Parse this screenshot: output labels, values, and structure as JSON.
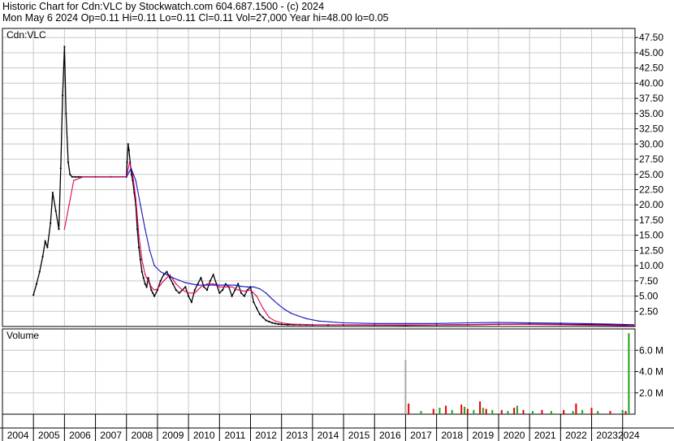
{
  "header": {
    "line1": "Historic Chart for Cdn:VLC by Stockwatch.com 604.687.1500 - (c) 2024",
    "line2": "Mon May  6 2024  Op=0.11  Hi=0.11  Lo=0.11  Cl=0.11  Vol=27,000  Year hi=48.00  lo=0.05"
  },
  "colors": {
    "price": "#000000",
    "ma_short": "#e00060",
    "ma_long": "#1010c0",
    "vol_up": "#20a020",
    "vol_down": "#e00000",
    "vol_big": "#a8a8a8",
    "grid": "#c8c8c8"
  },
  "chart_data": [
    {
      "type": "line",
      "title": "Cdn:VLC",
      "xlabel": "",
      "ylabel": "",
      "x_ticks": [
        "2004",
        "2005",
        "2006",
        "2007",
        "2008",
        "2009",
        "2010",
        "2011",
        "2012",
        "2013",
        "2014",
        "2015",
        "2016",
        "2017",
        "2018",
        "2019",
        "2020",
        "2021",
        "2022",
        "2023",
        "2024"
      ],
      "y_ticks": [
        "2.50",
        "5.00",
        "7.50",
        "10.00",
        "12.50",
        "15.00",
        "17.50",
        "20.00",
        "22.50",
        "25.00",
        "27.50",
        "30.00",
        "32.50",
        "35.00",
        "37.50",
        "40.00",
        "42.50",
        "45.00",
        "47.50"
      ],
      "ylim": [
        0,
        49
      ],
      "xlim": [
        2004.0,
        2024.4
      ],
      "grid": true,
      "series": [
        {
          "kind": "price",
          "x": [
            2005.0,
            2005.1,
            2005.2,
            2005.3,
            2005.38,
            2005.45,
            2005.55,
            2005.62,
            2005.72,
            2005.82,
            2005.88,
            2005.94,
            2006.0,
            2006.05,
            2006.12,
            2006.18,
            2006.25,
            2006.35,
            2006.45,
            2007.0,
            2007.5,
            2008.0,
            2008.02,
            2008.05,
            2008.08,
            2008.12,
            2008.16,
            2008.2,
            2008.25,
            2008.3,
            2008.35,
            2008.4,
            2008.45,
            2008.5,
            2008.55,
            2008.6,
            2008.65,
            2008.7,
            2008.75,
            2008.8,
            2008.85,
            2008.9,
            2009.0,
            2009.1,
            2009.2,
            2009.3,
            2009.4,
            2009.5,
            2009.6,
            2009.7,
            2009.8,
            2009.9,
            2010.0,
            2010.1,
            2010.2,
            2010.3,
            2010.4,
            2010.5,
            2010.6,
            2010.7,
            2010.8,
            2010.9,
            2011.0,
            2011.1,
            2011.2,
            2011.3,
            2011.4,
            2011.5,
            2011.6,
            2011.7,
            2011.8,
            2011.9,
            2012.0,
            2012.1,
            2012.2,
            2012.3,
            2012.4,
            2012.5,
            2012.6,
            2012.7,
            2012.8,
            2012.9,
            2013.0,
            2013.2,
            2013.4,
            2013.6,
            2013.8,
            2014.0,
            2014.5,
            2015.0,
            2016.0,
            2017.0,
            2018.0,
            2019.0,
            2020.0,
            2021.0,
            2022.0,
            2023.0,
            2024.0,
            2024.35
          ],
          "y": [
            5.2,
            7.0,
            9.0,
            11.5,
            14.0,
            13.0,
            17.0,
            22.0,
            19.0,
            16.0,
            26.0,
            38.0,
            46.0,
            35.0,
            27.0,
            25.0,
            24.6,
            24.6,
            24.6,
            24.6,
            24.6,
            24.6,
            27.0,
            30.0,
            29.0,
            27.0,
            25.0,
            24.0,
            22.0,
            20.0,
            16.0,
            13.0,
            11.0,
            9.0,
            8.0,
            7.0,
            6.5,
            8.0,
            7.0,
            6.0,
            5.5,
            5.0,
            6.0,
            7.5,
            8.5,
            9.0,
            8.0,
            7.0,
            6.0,
            5.5,
            6.0,
            6.5,
            5.0,
            4.0,
            6.0,
            7.0,
            8.0,
            6.5,
            6.0,
            7.5,
            8.5,
            7.0,
            5.5,
            6.0,
            7.0,
            6.5,
            5.0,
            6.0,
            7.0,
            5.5,
            5.0,
            6.0,
            6.5,
            4.0,
            3.0,
            2.0,
            1.5,
            1.0,
            0.8,
            0.6,
            0.5,
            0.4,
            0.35,
            0.3,
            0.3,
            0.28,
            0.27,
            0.26,
            0.25,
            0.25,
            0.24,
            0.2,
            0.25,
            0.3,
            0.35,
            0.4,
            0.35,
            0.3,
            0.2,
            0.11
          ]
        },
        {
          "kind": "short_ma",
          "x": [
            2006.0,
            2006.15,
            2006.3,
            2006.6,
            2007.0,
            2007.5,
            2008.0,
            2008.1,
            2008.2,
            2008.3,
            2008.4,
            2008.5,
            2008.6,
            2008.7,
            2008.8,
            2008.9,
            2009.0,
            2009.2,
            2009.4,
            2009.6,
            2009.8,
            2010.0,
            2010.2,
            2010.4,
            2010.6,
            2010.8,
            2011.0,
            2011.2,
            2011.4,
            2011.6,
            2011.8,
            2012.0,
            2012.2,
            2012.4,
            2012.6,
            2012.8,
            2013.0,
            2013.3,
            2013.6,
            2014.0,
            2015.0,
            2016.0,
            2017.0,
            2018.0,
            2019.0,
            2020.0,
            2021.0,
            2022.0,
            2023.0,
            2024.0,
            2024.35
          ],
          "y": [
            16.0,
            20.0,
            24.0,
            24.6,
            24.6,
            24.6,
            24.6,
            27.0,
            25.0,
            21.0,
            15.0,
            11.0,
            8.5,
            7.5,
            6.5,
            6.0,
            6.2,
            7.5,
            8.5,
            7.0,
            6.0,
            5.5,
            5.5,
            6.5,
            7.0,
            7.0,
            6.5,
            6.5,
            6.5,
            6.0,
            5.8,
            6.0,
            5.0,
            3.0,
            1.5,
            0.9,
            0.6,
            0.4,
            0.35,
            0.3,
            0.28,
            0.26,
            0.25,
            0.27,
            0.32,
            0.38,
            0.35,
            0.3,
            0.22,
            0.15,
            0.12
          ]
        },
        {
          "kind": "long_ma",
          "x": [
            2008.0,
            2008.15,
            2008.3,
            2008.45,
            2008.6,
            2008.75,
            2008.9,
            2009.1,
            2009.3,
            2009.5,
            2009.7,
            2009.9,
            2010.1,
            2010.3,
            2010.5,
            2010.7,
            2010.9,
            2011.1,
            2011.3,
            2011.5,
            2011.7,
            2011.9,
            2012.1,
            2012.3,
            2012.5,
            2012.7,
            2012.9,
            2013.1,
            2013.3,
            2013.5,
            2013.8,
            2014.2,
            2015.0,
            2016.0,
            2017.0,
            2018.0,
            2019.0,
            2020.0,
            2021.0,
            2022.0,
            2023.0,
            2024.0,
            2024.35
          ],
          "y": [
            24.6,
            26.0,
            24.0,
            20.0,
            16.0,
            12.5,
            10.0,
            9.0,
            8.5,
            8.0,
            7.6,
            7.2,
            7.0,
            6.8,
            6.8,
            6.8,
            6.8,
            6.8,
            6.8,
            6.8,
            6.6,
            6.5,
            6.5,
            6.2,
            5.5,
            4.5,
            3.6,
            2.8,
            2.2,
            1.8,
            1.3,
            0.9,
            0.6,
            0.5,
            0.5,
            0.5,
            0.6,
            0.65,
            0.6,
            0.55,
            0.45,
            0.35,
            0.3
          ]
        }
      ]
    },
    {
      "type": "bar",
      "title": "Volume",
      "y_ticks": [
        "2.0 M",
        "4.0 M",
        "6.0 M"
      ],
      "ylim": [
        0,
        8.0
      ],
      "unit": "M",
      "series": [
        {
          "kind": "volume",
          "x": [
            2017.0,
            2017.1,
            2017.5,
            2017.9,
            2018.1,
            2018.3,
            2018.5,
            2018.8,
            2018.9,
            2019.0,
            2019.2,
            2019.4,
            2019.5,
            2019.6,
            2019.8,
            2020.1,
            2020.3,
            2020.5,
            2020.6,
            2020.8,
            2021.1,
            2021.4,
            2021.7,
            2022.1,
            2022.4,
            2022.5,
            2022.7,
            2023.0,
            2023.2,
            2023.6,
            2024.0,
            2024.1,
            2024.2
          ],
          "y": [
            5.1,
            1.0,
            0.3,
            0.5,
            0.6,
            0.8,
            0.4,
            0.9,
            0.7,
            0.5,
            0.4,
            1.2,
            0.6,
            0.5,
            0.4,
            0.4,
            0.3,
            0.6,
            0.8,
            0.4,
            0.3,
            0.4,
            0.3,
            0.4,
            0.3,
            1.0,
            0.4,
            0.6,
            0.3,
            0.3,
            0.4,
            0.3,
            7.6
          ]
        }
      ]
    }
  ]
}
